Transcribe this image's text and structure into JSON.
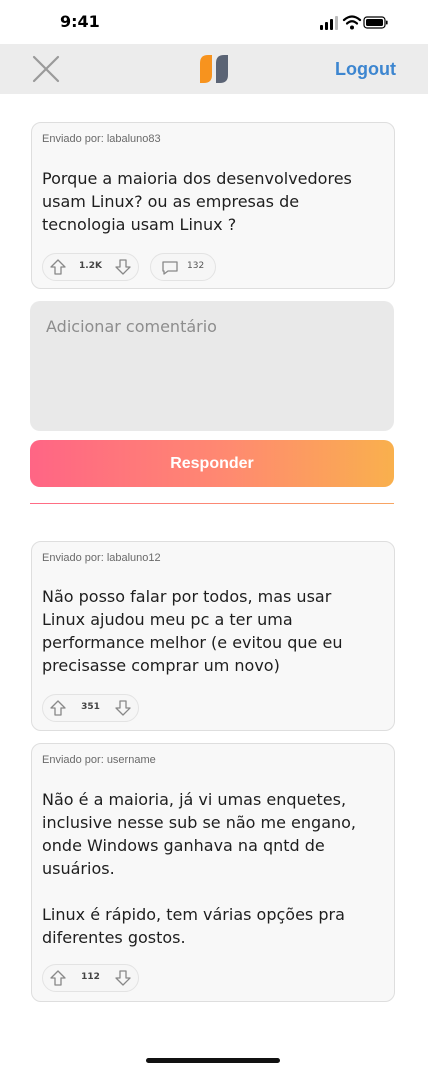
{
  "status_bar": {
    "time": "9:41"
  },
  "header": {
    "logout_label": "Logout"
  },
  "post": {
    "author": "Enviado por: labaluno83",
    "body": "Porque a maioria dos desenvolvedores\nusam Linux? ou as empresas de\ntecnologia usam Linux ?",
    "votes": "1.2K",
    "comments": "132"
  },
  "reply": {
    "placeholder": "Adicionar comentário",
    "button_label": "Responder"
  },
  "replies": [
    {
      "author": "Enviado por: labaluno12",
      "body": "Não posso falar por todos, mas usar\nLinux ajudou meu pc a ter uma\nperformance melhor (e evitou que eu\nprecisasse comprar um novo)",
      "votes": "351"
    },
    {
      "author": "Enviado por: username",
      "body": "Não é a maioria, já vi umas enquetes,\ninclusive nesse sub se não me engano,\nonde Windows ganhava na qntd de\nusuários.\n\nLinux é rápido, tem várias opções pra\ndiferentes gostos.",
      "votes": "112"
    }
  ],
  "colors": {
    "accent": "#3d86d0",
    "gradient_start": "#ff6585",
    "gradient_end": "#f9b04d",
    "logo_orange": "#f7931e",
    "logo_slate": "#5b6475"
  }
}
